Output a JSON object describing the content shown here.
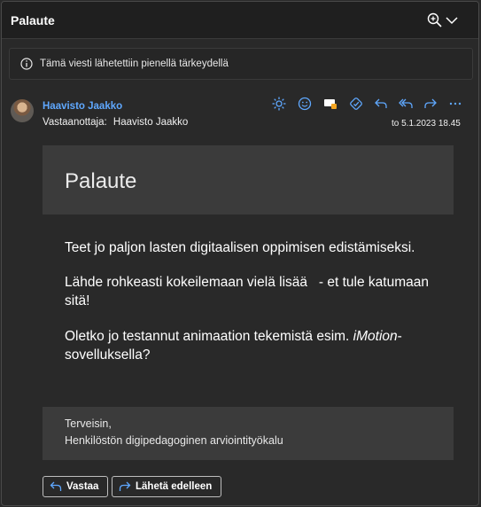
{
  "window": {
    "title": "Palaute"
  },
  "importance_notice": "Tämä viesti lähetettiin pienellä tärkeydellä",
  "message": {
    "sender": "Haavisto Jaakko",
    "to_label": "Vastaanottaja:",
    "to_name": "Haavisto Jaakko",
    "date": "to 5.1.2023 18.45"
  },
  "toolbar": {
    "icons": [
      "sun-icon",
      "emoji-icon",
      "tag-icon",
      "translate-icon",
      "reply-icon",
      "reply-all-icon",
      "forward-icon",
      "more-icon"
    ]
  },
  "body": {
    "heading": "Palaute",
    "paragraph1": "Teet jo paljon lasten digitaalisen oppimisen edistämiseksi.",
    "paragraph2": "Lähde rohkeasti kokeilemaan vielä lisää   - et tule katumaan sitä!",
    "paragraph3_start": "Oletko jo testannut animaation tekemistä esim. ",
    "paragraph3_app": "iMotion",
    "paragraph3_end": "-sovelluksella?",
    "signature_greeting": "Terveisin,",
    "signature_name": "Henkilöstön digipedagoginen arviointityökalu"
  },
  "buttons": {
    "reply": "Vastaa",
    "forward": "Lähetä edelleen"
  },
  "colors": {
    "accent": "#5fa8ff",
    "background": "#292929",
    "panel": "#3b3b3b"
  }
}
